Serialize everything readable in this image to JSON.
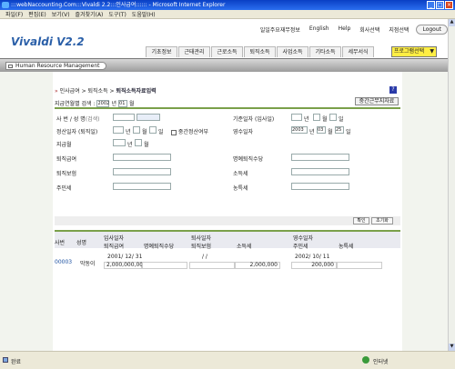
{
  "window": {
    "title": ":::webNaccounting.Com:::Vivaldi 2.2:::인사급여:::::: - Microsoft Internet Explorer"
  },
  "menu": [
    "파일(F)",
    "편집(E)",
    "보기(V)",
    "즐겨찾기(A)",
    "도구(T)",
    "도움말(H)"
  ],
  "app": {
    "logo": "Vivaldi V2.2",
    "toplinks": [
      "일일주요재무정보",
      "English",
      "Help",
      "회사선택",
      "지점선택",
      "Logout"
    ],
    "tabs": [
      "기초정보",
      "근태관리",
      "근로소득",
      "퇴직소득",
      "사업소득",
      "기타소득",
      "세무서식"
    ],
    "program_select": "프로그램선택",
    "section_label": "Human Resource Management"
  },
  "breadcrumb": {
    "path": "인사급여 > 퇴직소득 > ",
    "current": "퇴직소득자료입력"
  },
  "filter": {
    "label": "지급연월별 검색 :",
    "year": "2002",
    "year_unit": "년",
    "month": "01",
    "month_unit": "월"
  },
  "interim_button": "중간근무지자료",
  "form": {
    "employee": {
      "label": "사 번 / 성 명",
      "search": "(검색)"
    },
    "base_date": {
      "label": "기준일자 (입사일)",
      "y": "년",
      "m": "월",
      "d": "일"
    },
    "settle_date": {
      "label": "정산일자 (퇴직일)",
      "y": "년",
      "m": "월",
      "d": "일",
      "checkbox": "중간정산여부"
    },
    "receipt_date": {
      "label": "영수일자",
      "year": "2003",
      "y": "년",
      "month": "03",
      "m": "월",
      "day": "25",
      "d": "일"
    },
    "pay_date": {
      "label": "지급월",
      "y": "년",
      "m": "월"
    },
    "retire_pay": "퇴직급여",
    "honor_pay": "명예퇴직수당",
    "retire_insurance": "퇴직보험",
    "income_tax": "소득세",
    "resident_tax": "주민세",
    "farm_tax": "농특세"
  },
  "buttons": {
    "confirm": "확인",
    "reset": "초기화"
  },
  "table": {
    "headers": {
      "emp_no": "사번",
      "name": "성명",
      "join_date": "입사일자",
      "retire_date": "퇴사일자",
      "receipt_date": "영수일자",
      "retire_pay": "퇴직급여",
      "honor_pay": "명예퇴직수당",
      "insurance": "퇴직보험",
      "income_tax": "소득세",
      "resident_tax": "주민세",
      "farm_tax": "농특세"
    },
    "rows": [
      {
        "emp_no": "00003",
        "name": "막동이",
        "join_date": "2001/ 12/ 31",
        "retire_date": "/ /",
        "receipt_date": "2002/ 10/ 11",
        "retire_pay": "2,000,000,000",
        "honor_pay": "",
        "insurance": "",
        "income_tax": "2,000,000",
        "resident_tax": "200,000",
        "farm_tax": ""
      }
    ]
  },
  "status": {
    "left": "완료",
    "right": "인터넷"
  },
  "colors": {
    "accent_green": "#7aa04a",
    "title_blue": "#0a3fc4",
    "logo_blue": "#2a5fa8",
    "select_yellow": "#ffee44"
  }
}
